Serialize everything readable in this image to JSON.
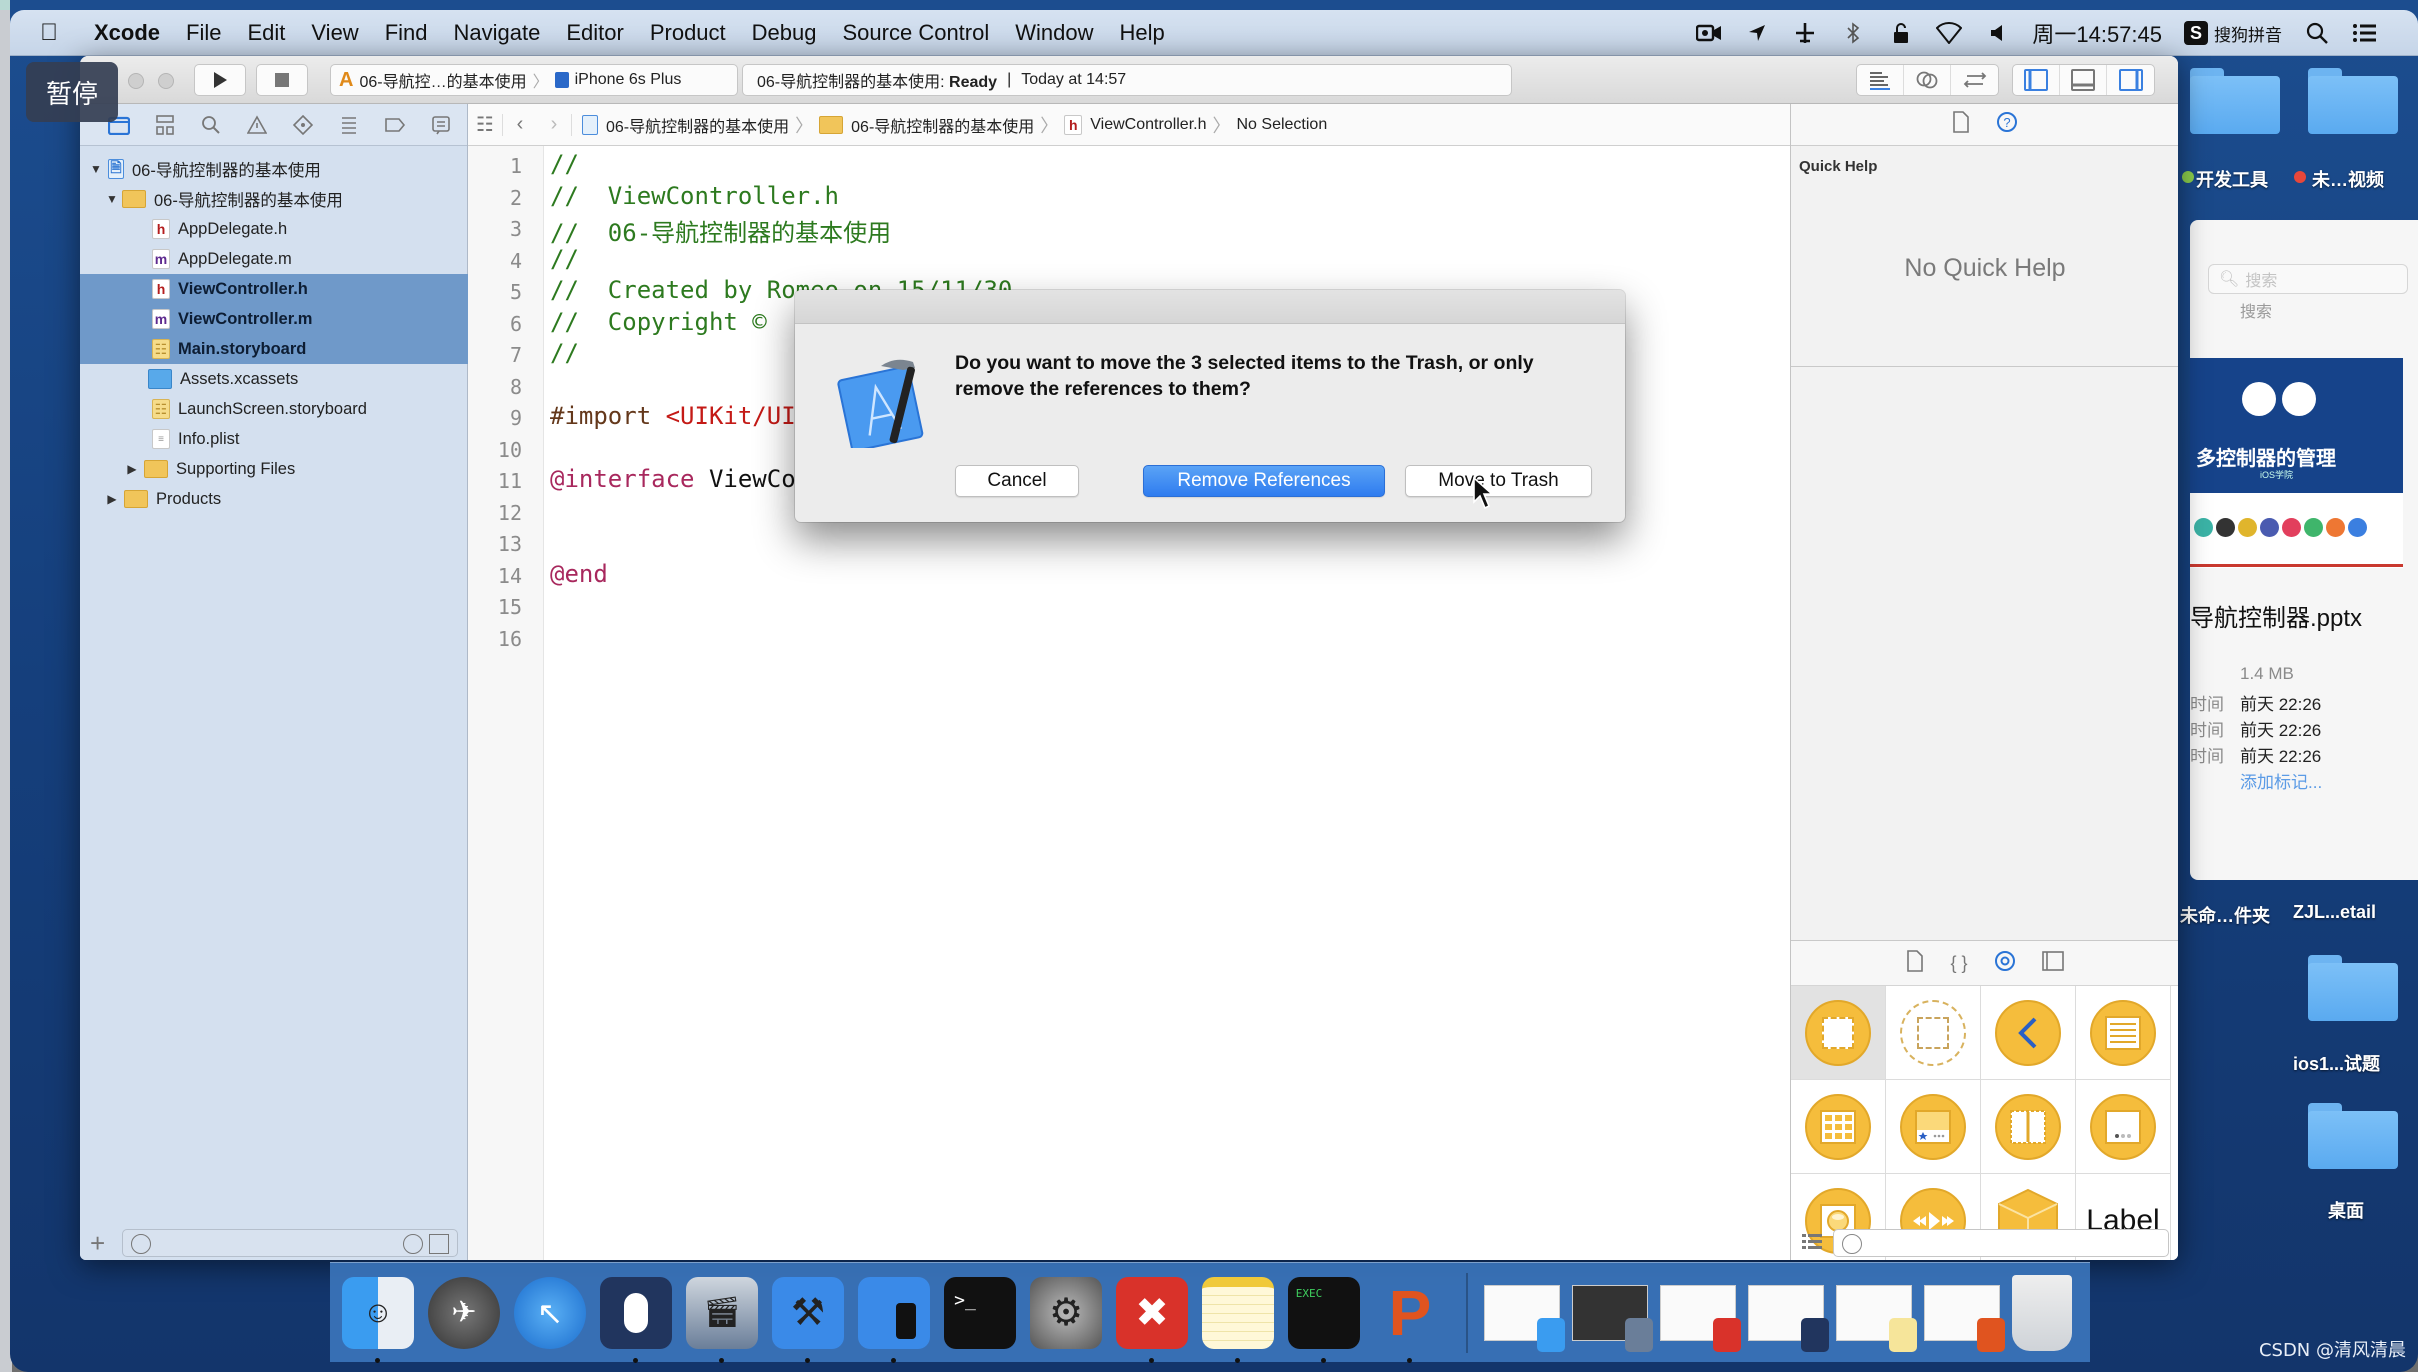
{
  "menubar": {
    "app_name": "Xcode",
    "items": [
      "File",
      "Edit",
      "View",
      "Find",
      "Navigate",
      "Editor",
      "Product",
      "Debug",
      "Source Control",
      "Window",
      "Help"
    ],
    "clock": "周一14:57:45",
    "input_method": "搜狗拼音",
    "input_method_icon": "S"
  },
  "overlay": {
    "pause_label": "暂停"
  },
  "toolbar": {
    "scheme_name": "06-导航控…的基本使用",
    "device_name": "iPhone 6s Plus",
    "activity_project": "06-导航控制器的基本使用:",
    "activity_status": "Ready",
    "activity_separator": "|",
    "activity_time": "Today at 14:57"
  },
  "navigator": {
    "tree": [
      {
        "label": "06-导航控制器的基本使用",
        "type": "project",
        "expanded": true,
        "selected": false
      },
      {
        "label": "06-导航控制器的基本使用",
        "type": "folder",
        "expanded": true,
        "selected": false
      },
      {
        "label": "AppDelegate.h",
        "type": "h",
        "selected": false
      },
      {
        "label": "AppDelegate.m",
        "type": "m",
        "selected": false
      },
      {
        "label": "ViewController.h",
        "type": "h",
        "selected": true
      },
      {
        "label": "ViewController.m",
        "type": "m",
        "selected": true
      },
      {
        "label": "Main.storyboard",
        "type": "storyboard",
        "selected": true
      },
      {
        "label": "Assets.xcassets",
        "type": "xcassets",
        "selected": false
      },
      {
        "label": "LaunchScreen.storyboard",
        "type": "storyboard",
        "selected": false
      },
      {
        "label": "Info.plist",
        "type": "plist",
        "selected": false
      },
      {
        "label": "Supporting Files",
        "type": "folder",
        "expanded": false,
        "selected": false
      },
      {
        "label": "Products",
        "type": "folder",
        "expanded": false,
        "selected": false
      }
    ]
  },
  "jumpbar": {
    "crumbs": [
      "06-导航控制器的基本使用",
      "06-导航控制器的基本使用",
      "ViewController.h",
      "No Selection"
    ]
  },
  "editor": {
    "lines": [
      {
        "n": "1",
        "text": "//"
      },
      {
        "n": "2",
        "text": "//  ViewController.h"
      },
      {
        "n": "3",
        "text": "//  06-导航控制器的基本使用"
      },
      {
        "n": "4",
        "text": "//"
      },
      {
        "n": "5",
        "text": "//  Created by Romeo on 15/11/30."
      },
      {
        "n": "6",
        "text": "//  Copyright ©"
      },
      {
        "n": "7",
        "text": "//"
      },
      {
        "n": "8",
        "text": ""
      },
      {
        "n": "9",
        "text_pre": "#import ",
        "text_str": "<UIKit/UIKit.h>"
      },
      {
        "n": "10",
        "text": ""
      },
      {
        "n": "11",
        "text_kw": "@interface",
        "text_rest": " ViewController"
      },
      {
        "n": "12",
        "text": ""
      },
      {
        "n": "13",
        "text": ""
      },
      {
        "n": "14",
        "text_kw": "@end"
      },
      {
        "n": "15",
        "text": ""
      },
      {
        "n": "16",
        "text": ""
      }
    ]
  },
  "inspector": {
    "quick_help_title": "Quick Help",
    "quick_help_empty": "No Quick Help",
    "library_items": [
      "View Controller",
      "Storyboard Reference",
      "Navigation Controller",
      "Table View Controller",
      "Collection View Controller",
      "Tab Bar Controller",
      "Split View Controller",
      "Page View Controller",
      "GLKit View Controller",
      "AVKit Player View Controller",
      "Object",
      "Label"
    ],
    "library_label_text": "Label"
  },
  "dialog": {
    "message": "Do you want to move the 3 selected items to the Trash, or only remove the references to them?",
    "cancel_label": "Cancel",
    "remove_label": "Remove References",
    "trash_label": "Move to Trash"
  },
  "desktop": {
    "folder_labels_top": [
      "开发工具",
      "未…视频"
    ],
    "tag_colors": [
      "#8ccf4d",
      "#e8473a"
    ],
    "folder_labels_bottom": [
      "未命…件夹",
      "ZJL...etail"
    ],
    "folder_ios": "ios1...试题",
    "folder_desktop": "桌面"
  },
  "finder_preview": {
    "search_placeholder": "搜索",
    "search_caption": "搜索",
    "thumb_title": "多控制器的管理",
    "thumb_subtitle": "iOS学院",
    "file_name": "导航控制器.pptx",
    "size": "1.4 MB",
    "meta_labels": [
      "时间",
      "时间",
      "时间"
    ],
    "meta_values": [
      "前天 22:26",
      "前天 22:26",
      "前天 22:26"
    ],
    "add_tag": "添加标记..."
  },
  "dock": {
    "apps": [
      "Finder",
      "Launchpad",
      "Safari",
      "Mouse App",
      "Photo Booth Movie",
      "Xcode",
      "Simulator",
      "Terminal",
      "System Preferences",
      "XMind",
      "Notes",
      "Console",
      "PowerPoint"
    ],
    "running": [
      true,
      false,
      false,
      true,
      true,
      true,
      true,
      false,
      false,
      true,
      true,
      true,
      true
    ],
    "windows": [
      "Finder window",
      "Movie window",
      "XMind window",
      "Mouse window",
      "Notes window",
      "PowerPoint window"
    ],
    "trash": "Trash"
  },
  "watermark": "CSDN @清风清晨"
}
